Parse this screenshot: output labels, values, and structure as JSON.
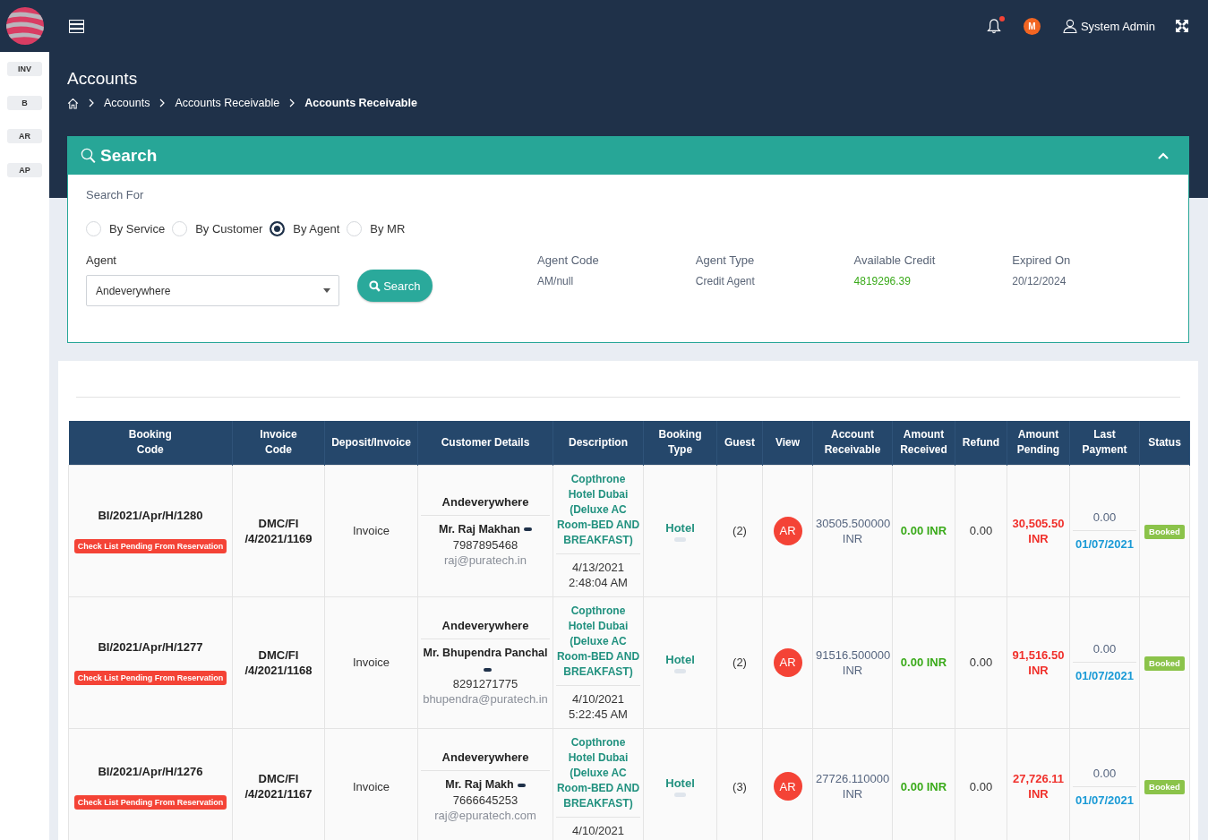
{
  "sidebar": {
    "tabs": [
      {
        "label": "INV"
      },
      {
        "label": "B"
      },
      {
        "label": "AR"
      },
      {
        "label": "AP"
      }
    ]
  },
  "top_bar": {
    "unread_notifications": true,
    "avatar_initial": "M",
    "user_name": "System Admin"
  },
  "header": {
    "title": "Accounts",
    "breadcrumb": [
      {
        "label": "Accounts",
        "current": false
      },
      {
        "label": "Accounts Receivable",
        "current": false
      },
      {
        "label": "Accounts Receivable",
        "current": true
      }
    ]
  },
  "search_panel": {
    "title": "Search",
    "expanded": true,
    "search_for": {
      "label": "Search For",
      "options": [
        {
          "label": "By Service",
          "selected": false
        },
        {
          "label": "By Customer",
          "selected": false
        },
        {
          "label": "By Agent",
          "selected": true
        },
        {
          "label": "By MR",
          "selected": false
        }
      ]
    },
    "agent_field": {
      "label": "Agent",
      "value": "Andeverywhere"
    },
    "search_button": "Search",
    "agent_info": [
      {
        "label": "Agent Code",
        "value": "AM/null",
        "kind": "plain"
      },
      {
        "label": "Agent Type",
        "value": "Credit Agent",
        "kind": "plain"
      },
      {
        "label": "Available Credit",
        "value": "4819296.39",
        "kind": "credit"
      },
      {
        "label": "Expired On",
        "value": "20/12/2024",
        "kind": "plain"
      }
    ]
  },
  "table": {
    "columns": [
      "Booking Code",
      "Invoice Code",
      "Deposit/Invoice",
      "Customer Details",
      "Description",
      "Booking Type",
      "Guest",
      "View",
      "Account Receivable",
      "Amount Received",
      "Refund",
      "Amount Pending",
      "Last Payment",
      "Status"
    ],
    "rows": [
      {
        "booking_code": "BI/2021/Apr/H/1280",
        "checklist_note": "Check List Pending From Reservation",
        "invoice_code": "DMC/FI /4/2021/1169",
        "deposit_invoice": "Invoice",
        "agent": "Andeverywhere",
        "customer_name": "Mr. Raj Makhan",
        "phone": "7987895468",
        "email": "raj@puratech.in",
        "description": "Copthrone Hotel Dubai (Deluxe AC Room-BED AND BREAKFAST)",
        "booked_date": "4/13/2021",
        "booked_time": "2:48:04 AM",
        "booking_type": "Hotel",
        "guest": "(2)",
        "view_button": "AR",
        "account_receivable": "30505.500000 INR",
        "amount_received": "0.00 INR",
        "refund": "0.00",
        "amount_pending": "30,505.50 INR",
        "last_payment_amount": "0.00",
        "last_payment_date": "01/07/2021",
        "status": "Booked"
      },
      {
        "booking_code": "BI/2021/Apr/H/1277",
        "checklist_note": "Check List Pending From Reservation",
        "invoice_code": "DMC/FI /4/2021/1168",
        "deposit_invoice": "Invoice",
        "agent": "Andeverywhere",
        "customer_name": "Mr. Bhupendra Panchal",
        "phone": "8291271775",
        "email": "bhupendra@puratech.in",
        "description": "Copthrone Hotel Dubai (Deluxe AC Room-BED AND BREAKFAST)",
        "booked_date": "4/10/2021",
        "booked_time": "5:22:45 AM",
        "booking_type": "Hotel",
        "guest": "(2)",
        "view_button": "AR",
        "account_receivable": "91516.500000 INR",
        "amount_received": "0.00 INR",
        "refund": "0.00",
        "amount_pending": "91,516.50 INR",
        "last_payment_amount": "0.00",
        "last_payment_date": "01/07/2021",
        "status": "Booked"
      },
      {
        "booking_code": "BI/2021/Apr/H/1276",
        "checklist_note": "Check List Pending From Reservation",
        "invoice_code": "DMC/FI /4/2021/1167",
        "deposit_invoice": "Invoice",
        "agent": "Andeverywhere",
        "customer_name": "Mr. Raj Makh",
        "phone": "7666645253",
        "email": "raj@epuratech.com",
        "description": "Copthrone Hotel Dubai (Deluxe AC Room-BED AND BREAKFAST)",
        "booked_date": "4/10/2021",
        "booking_type": "Hotel",
        "guest": "(3)",
        "view_button": "AR",
        "account_receivable": "27726.110000 INR",
        "amount_received": "0.00 INR",
        "refund": "0.00",
        "amount_pending": "27,726.11 INR",
        "last_payment_amount": "0.00",
        "last_payment_date": "01/07/2021",
        "status": "Booked"
      }
    ]
  }
}
